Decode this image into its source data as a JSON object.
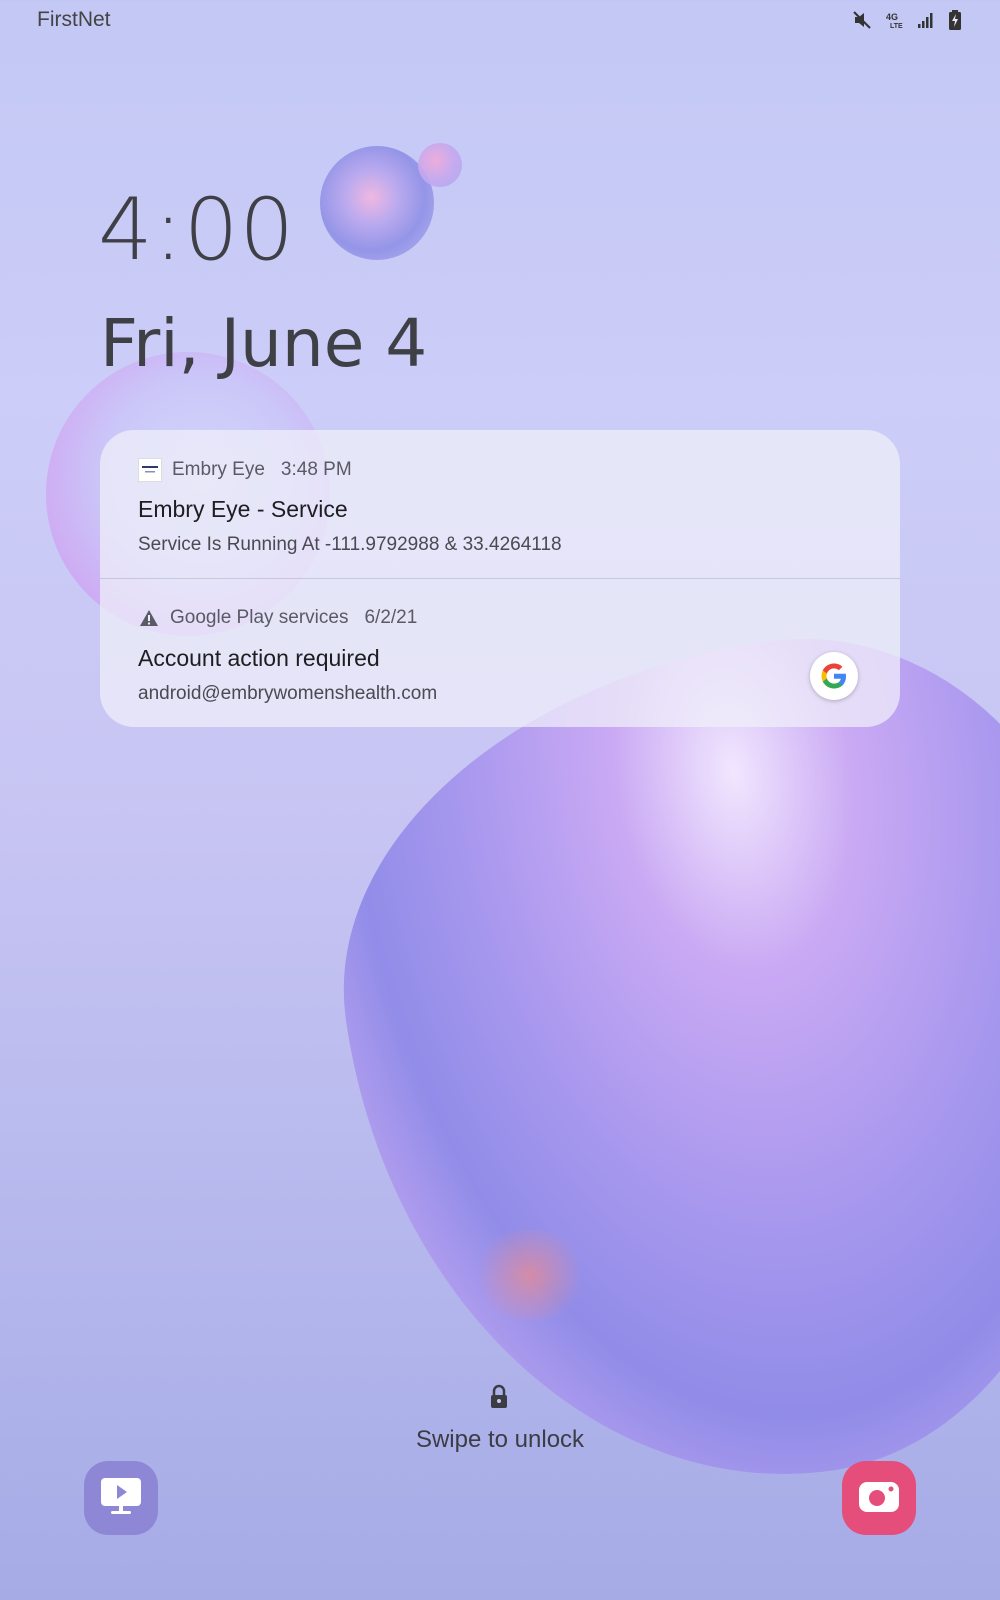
{
  "status_bar": {
    "carrier": "FirstNet",
    "icons": [
      "mute-icon",
      "4g-lte-icon",
      "signal-icon",
      "battery-charging-icon"
    ],
    "network_label": "4G LTE"
  },
  "lockscreen": {
    "time": "4:00",
    "date": "Fri, June 4",
    "unlock_hint": "Swipe to unlock"
  },
  "notifications": [
    {
      "app": "Embry Eye",
      "time": "3:48 PM",
      "title": "Embry Eye - Service",
      "body": "Service Is Running At -111.9792988 & 33.4264118"
    },
    {
      "app": "Google Play services",
      "time": "6/2/21",
      "title": "Account action required",
      "body": "android@embrywomenshealth.com"
    }
  ],
  "shortcuts": {
    "left": "video-player-icon",
    "right": "camera-icon"
  },
  "colors": {
    "camera_shortcut": "#e54d7a",
    "video_shortcut": "#8d87d6"
  }
}
